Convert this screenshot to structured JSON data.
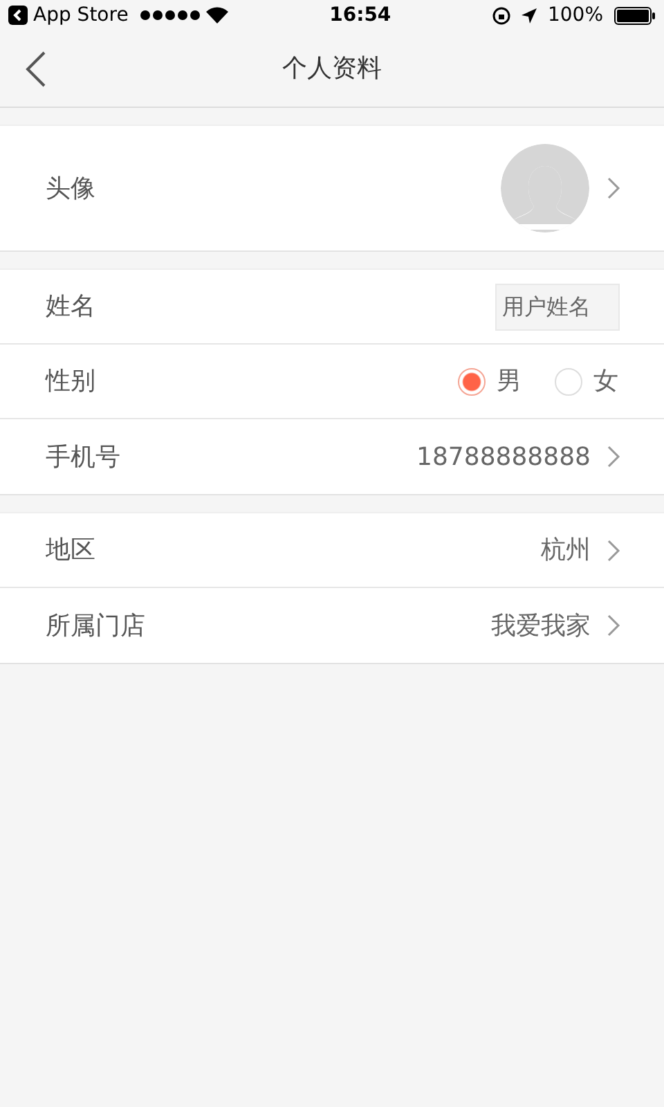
{
  "status_bar": {
    "back_app": "App Store",
    "time": "16:54",
    "battery": "100%"
  },
  "nav": {
    "title": "个人资料"
  },
  "sections": [
    {
      "rows": [
        {
          "kind": "avatar",
          "label": "头像"
        }
      ]
    },
    {
      "rows": [
        {
          "kind": "input",
          "label": "姓名",
          "placeholder": "用户姓名"
        },
        {
          "kind": "radio",
          "label": "性别",
          "options": [
            {
              "label": "男",
              "selected": true
            },
            {
              "label": "女",
              "selected": false
            }
          ]
        },
        {
          "kind": "link",
          "label": "手机号",
          "value": "18788888888"
        }
      ]
    },
    {
      "rows": [
        {
          "kind": "link",
          "label": "地区",
          "value": "杭州"
        },
        {
          "kind": "link",
          "label": "所属门店",
          "value": "我爱我家"
        }
      ]
    }
  ]
}
